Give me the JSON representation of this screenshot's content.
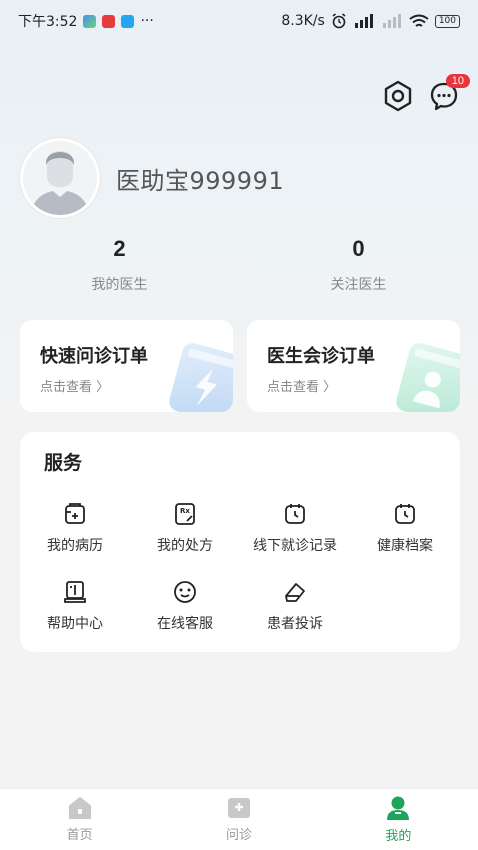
{
  "status_bar": {
    "time": "下午3:52",
    "dots": "···",
    "speed": "8.3K/s",
    "battery": "100"
  },
  "header": {
    "badge_count": "10"
  },
  "profile": {
    "username": "医助宝999991"
  },
  "stats": [
    {
      "value": "2",
      "label": "我的医生"
    },
    {
      "value": "0",
      "label": "关注医生"
    }
  ],
  "orders": [
    {
      "title": "快速问诊订单",
      "sub": "点击查看",
      "color": "#cfe2f6",
      "icon": "lightning-icon"
    },
    {
      "title": "医生会诊订单",
      "sub": "点击查看",
      "color": "#c9efe0",
      "icon": "doctor-icon"
    }
  ],
  "services": {
    "title": "服务",
    "items": [
      {
        "label": "我的病历",
        "icon": "medical-record-icon"
      },
      {
        "label": "我的处方",
        "icon": "prescription-icon"
      },
      {
        "label": "线下就诊记录",
        "icon": "clinic-record-icon"
      },
      {
        "label": "健康档案",
        "icon": "health-file-icon"
      },
      {
        "label": "帮助中心",
        "icon": "help-book-icon"
      },
      {
        "label": "在线客服",
        "icon": "customer-service-icon"
      },
      {
        "label": "患者投诉",
        "icon": "complaint-icon"
      }
    ]
  },
  "tabbar": {
    "items": [
      {
        "label": "首页",
        "icon": "home-icon",
        "active": false
      },
      {
        "label": "问诊",
        "icon": "consult-icon",
        "active": false
      },
      {
        "label": "我的",
        "icon": "profile-icon",
        "active": true
      }
    ],
    "active_color": "#1fa45b"
  }
}
